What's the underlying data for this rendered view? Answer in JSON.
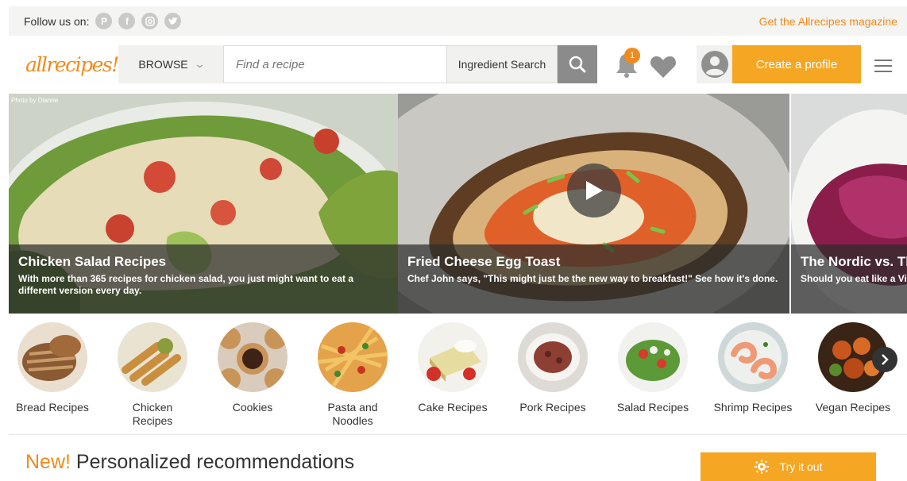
{
  "follow_bar": {
    "label": "Follow us on:",
    "social_icons": [
      "pinterest-icon",
      "facebook-icon",
      "instagram-icon",
      "twitter-icon"
    ],
    "magazine_link": "Get the Allrecipes magazine"
  },
  "header": {
    "logo": "allrecipes",
    "browse_label": "BROWSE",
    "search_placeholder": "Find a recipe",
    "ingredient_search_label": "Ingredient Search",
    "notification_count": "1",
    "create_profile_label": "Create a profile"
  },
  "hero": {
    "photo_credit": "Photo by Dianne",
    "slides": [
      {
        "title": "Chicken Salad Recipes",
        "description": "With more than 365 recipes for chicken salad, you just might want to eat a different version every day."
      },
      {
        "title": "Fried Cheese Egg Toast",
        "description": "Chef John says, \"This might just be the new way to breakfast!\" See how it's done."
      },
      {
        "title": "The Nordic vs. The",
        "description": "Should you eat like a Vi"
      }
    ]
  },
  "categories": [
    {
      "label": "Bread Recipes"
    },
    {
      "label": "Chicken Recipes"
    },
    {
      "label": "Cookies"
    },
    {
      "label": "Pasta and Noodles"
    },
    {
      "label": "Cake Recipes"
    },
    {
      "label": "Pork Recipes"
    },
    {
      "label": "Salad Recipes"
    },
    {
      "label": "Shrimp Recipes"
    },
    {
      "label": "Vegan Recipes"
    }
  ],
  "recommendations": {
    "new_label": "New!",
    "title": "Personalized recommendations",
    "try_label": "Try it out"
  },
  "colors": {
    "brand_orange": "#f18a1c",
    "button_orange": "#f5a623"
  }
}
